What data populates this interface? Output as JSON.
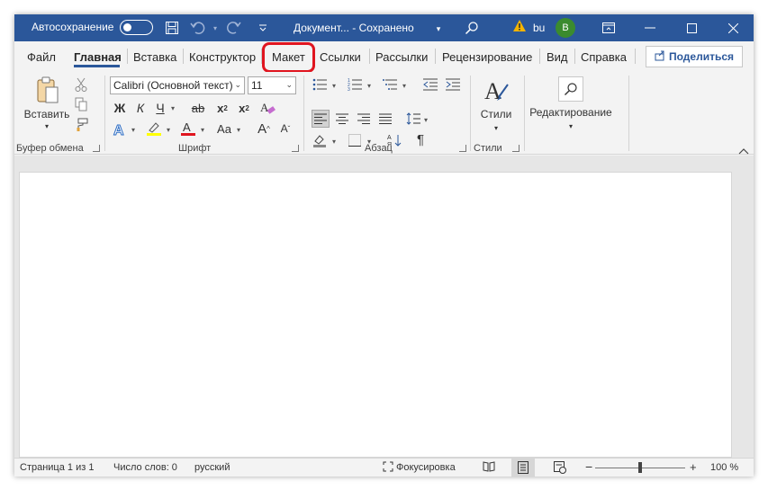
{
  "titlebar": {
    "autosave_label": "Автосохранение",
    "doc_title": "Документ... - Сохранено",
    "user_initials": "bu",
    "avatar_letter": "B",
    "accent_color": "#2b579a"
  },
  "tabs": {
    "items": [
      "Файл",
      "Главная",
      "Вставка",
      "Конструктор",
      "Макет",
      "Ссылки",
      "Рассылки",
      "Рецензирование",
      "Вид",
      "Справка"
    ],
    "active": "Главная",
    "highlighted": "Макет",
    "share_label": "Поделиться"
  },
  "ribbon": {
    "clipboard": {
      "paste_label": "Вставить",
      "group_label": "Буфер обмена"
    },
    "font": {
      "font_name": "Calibri (Основной текст)",
      "font_size": "11",
      "bold": "Ж",
      "italic": "К",
      "underline": "Ч",
      "strike": "ab",
      "subscript": "x",
      "superscript": "x",
      "case": "Aa",
      "grow": "A",
      "shrink": "A",
      "group_label": "Шрифт"
    },
    "paragraph": {
      "group_label": "Абзац"
    },
    "styles": {
      "label": "Стили",
      "group_label": "Стили"
    },
    "editing": {
      "label": "Редактирование"
    }
  },
  "statusbar": {
    "page_info": "Страница 1 из 1",
    "word_count": "Число слов: 0",
    "language": "русский",
    "focus": "Фокусировка",
    "zoom_minus": "−",
    "zoom_plus": "+",
    "zoom_level": "100 %"
  },
  "colors": {
    "highlight_ring": "#e0151f",
    "text_highlight": "#ffff00",
    "font_color": "#e0151f"
  }
}
